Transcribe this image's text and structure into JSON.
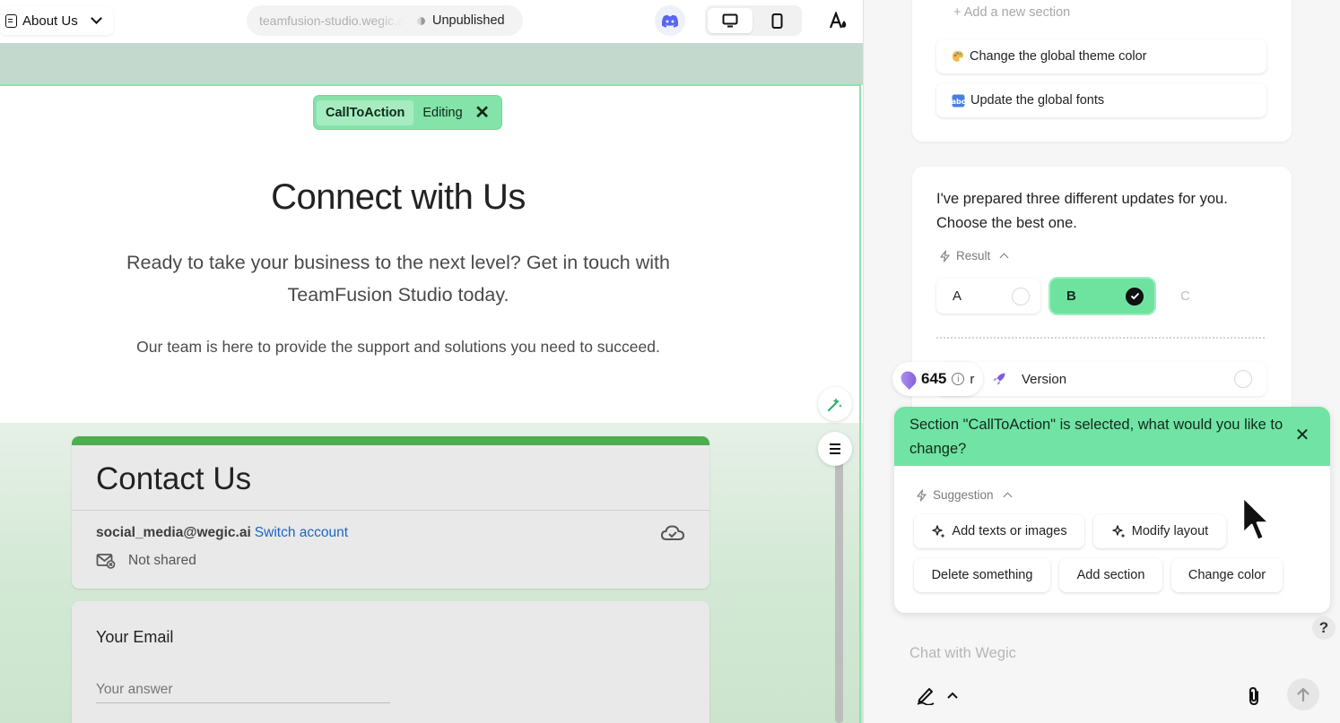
{
  "topbar": {
    "page_name": "About Us",
    "url": "teamfusion-studio.wegic.ai",
    "publish_status": "Unpublished"
  },
  "editor": {
    "section_label": "CallToAction",
    "section_mode": "Editing",
    "cta_title": "Connect with Us",
    "cta_lead": "Ready to take your business to the next level? Get in touch with TeamFusion Studio today.",
    "cta_sub": "Our team is here to provide the support and solutions you need to succeed.",
    "form": {
      "title": "Contact Us",
      "account": "social_media@wegic.ai",
      "switch_account": "Switch account",
      "not_shared": "Not shared",
      "email_label": "Your Email",
      "email_placeholder": "Your answer"
    }
  },
  "chat": {
    "add_new_section": "Add a new section",
    "suggestion_theme": "Change the global theme color",
    "suggestion_fonts": "Update the global fonts",
    "result_message": "I've prepared three different updates for you. Choose the best one.",
    "result_label": "Result",
    "options": [
      {
        "label": "A",
        "selected": false
      },
      {
        "label": "B",
        "selected": true
      },
      {
        "label": "C",
        "selected": false
      }
    ],
    "credits": "645",
    "credits_suffix": "r",
    "version_label": "Version",
    "selected_banner": "Section \"CallToAction\" is selected, what would you like to change?",
    "suggestion_label": "Suggestion",
    "chips": {
      "add_texts": "Add texts or images",
      "modify_layout": "Modify layout",
      "delete_something": "Delete something",
      "add_section": "Add section",
      "change_color": "Change color"
    },
    "input_placeholder": "Chat with Wegic",
    "help": "?"
  },
  "colors": {
    "accent_green": "#6ee3a0",
    "form_header_bar": "#4ead50",
    "link_blue": "#1a66c8"
  },
  "icons": {
    "theme": "palette-icon",
    "fonts": "font-icon",
    "discord": "discord-icon"
  }
}
